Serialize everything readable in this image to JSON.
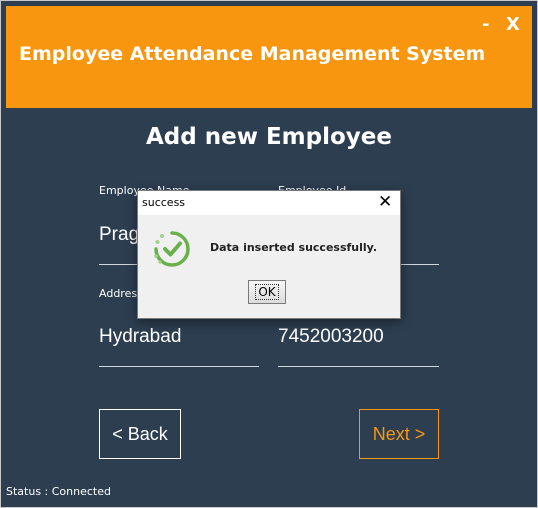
{
  "window": {
    "app_title": "Employee Attendance Management System",
    "minimize_label": "-",
    "close_label": "X"
  },
  "form": {
    "title": "Add new Employee",
    "fields": {
      "name": {
        "label": "Employee Name",
        "value": "Prag"
      },
      "id": {
        "label": "Employee Id",
        "value": ""
      },
      "address": {
        "label": "Address",
        "value": "Hydrabad"
      },
      "phone": {
        "label": "",
        "value": "7452003200"
      }
    },
    "back_label": "< Back",
    "next_label": "Next >",
    "status": "Status : Connected"
  },
  "dialog": {
    "title": "success",
    "close_label": "✕",
    "message": "Data inserted successfully.",
    "ok_label": "OK",
    "icon": "success-check-icon"
  },
  "colors": {
    "header": "#f8960f",
    "panel": "#2c3e50",
    "accent": "#f8960f",
    "success_green": "#6ab04c"
  }
}
